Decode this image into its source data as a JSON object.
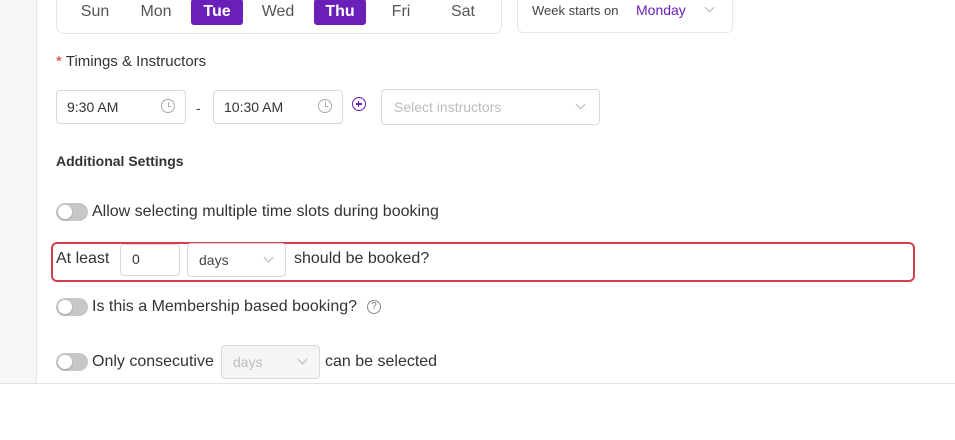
{
  "days": {
    "items": [
      {
        "label": "Sun",
        "active": false
      },
      {
        "label": "Mon",
        "active": false
      },
      {
        "label": "Tue",
        "active": true
      },
      {
        "label": "Wed",
        "active": false
      },
      {
        "label": "Thu",
        "active": true
      },
      {
        "label": "Fri",
        "active": false
      },
      {
        "label": "Sat",
        "active": false
      }
    ]
  },
  "week_start": {
    "label": "Week starts on",
    "value": "Monday"
  },
  "timings": {
    "required_mark": "*",
    "label": "Timings & Instructors",
    "start_time": "9:30 AM",
    "separator": "-",
    "end_time": "10:30 AM",
    "instructors_placeholder": "Select instructors"
  },
  "additional_settings": {
    "heading": "Additional Settings",
    "multiple_slots_label": "Allow selecting multiple time slots during booking",
    "min_booking": {
      "prefix": "At least",
      "value": "0",
      "unit": "days",
      "suffix": "should be booked?"
    },
    "membership_label": "Is this a Membership based booking?",
    "help_glyph": "?",
    "consecutive": {
      "prefix": "Only consecutive",
      "unit": "days",
      "suffix": "can be selected"
    }
  },
  "colors": {
    "accent": "#6a1fb8",
    "highlight_border": "#d23f4f",
    "required": "#d8352f",
    "toggle_off": "#c7c7c7"
  }
}
